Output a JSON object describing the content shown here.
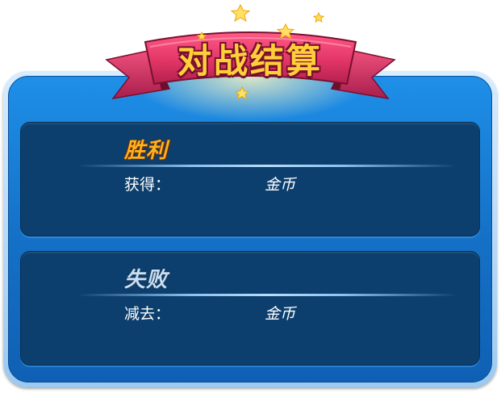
{
  "header": {
    "title": "对战结算"
  },
  "win_panel": {
    "title": "胜利",
    "label": "获得：",
    "currency": "金币"
  },
  "lose_panel": {
    "title": "失败",
    "label": "减去：",
    "currency": "金币"
  },
  "colors": {
    "frame": "#1572c8",
    "panel": "#0c3f6e",
    "ribbon": "#e03a6a",
    "ribbon_dark": "#a81e4c",
    "win_title": "#ffb21f",
    "lose_title": "#c8dff5",
    "banner_text": "#ffcf3a"
  },
  "icons": [
    "star-icon"
  ]
}
